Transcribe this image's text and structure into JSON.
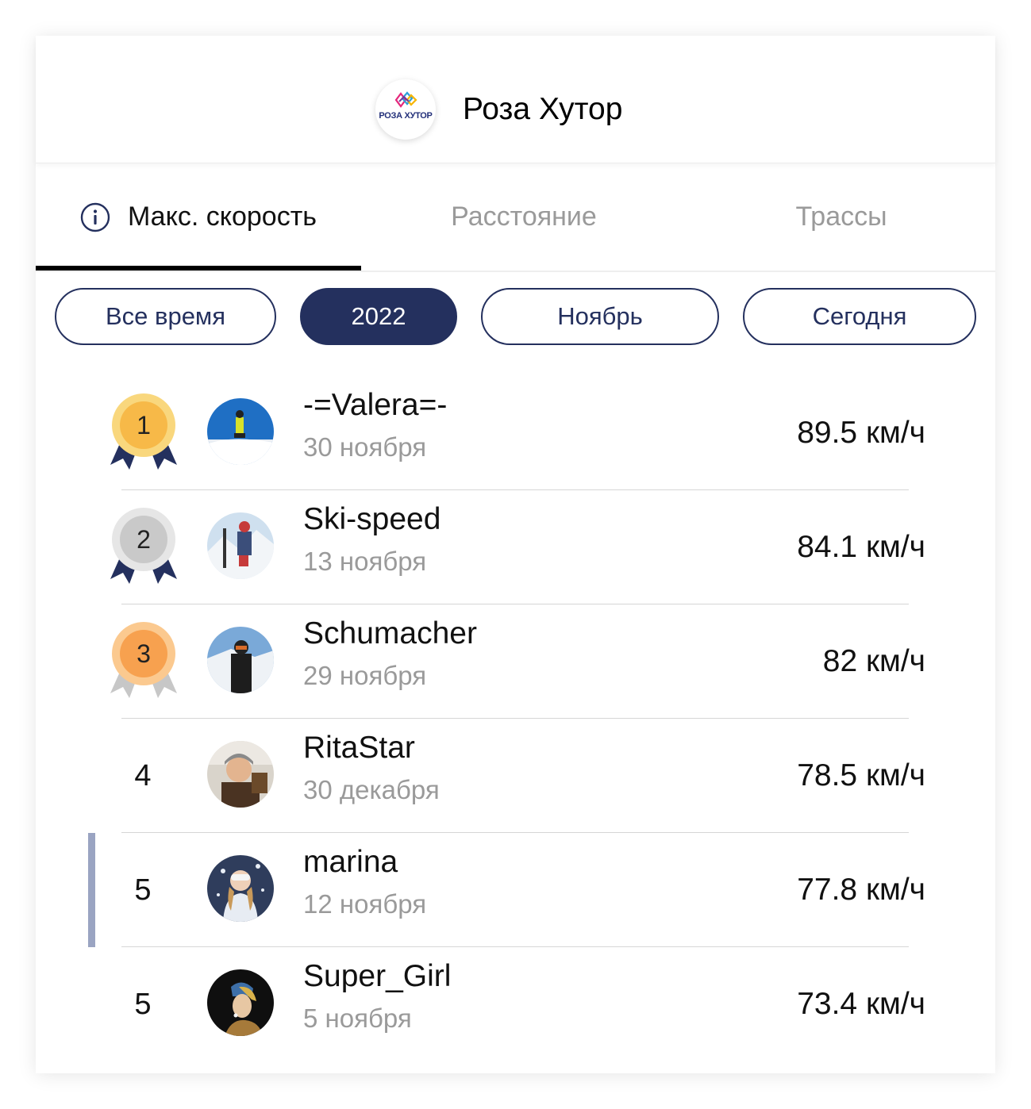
{
  "header": {
    "logo_text": "РОЗА ХУТОР",
    "title": "Роза Хутор"
  },
  "tabs": [
    {
      "label": "Макс. скорость",
      "active": true,
      "icon": "info-icon"
    },
    {
      "label": "Расстояние",
      "active": false
    },
    {
      "label": "Трассы",
      "active": false
    }
  ],
  "filters": [
    {
      "label": "Все время",
      "selected": false
    },
    {
      "label": "2022",
      "selected": true
    },
    {
      "label": "Ноябрь",
      "selected": false
    },
    {
      "label": "Сегодня",
      "selected": false
    }
  ],
  "leaderboard": [
    {
      "rank": "1",
      "medal": "gold",
      "name": "-=Valera=-",
      "date": "30 ноября",
      "speed": "89.5 км/ч"
    },
    {
      "rank": "2",
      "medal": "silver",
      "name": "Ski-speed",
      "date": "13 ноября",
      "speed": "84.1 км/ч"
    },
    {
      "rank": "3",
      "medal": "bronze",
      "name": "Schumacher",
      "date": "29 ноября",
      "speed": "82 км/ч"
    },
    {
      "rank": "4",
      "medal": "",
      "name": "RitaStar",
      "date": "30 декабря",
      "speed": "78.5 км/ч"
    },
    {
      "rank": "5",
      "medal": "",
      "name": "marina",
      "date": "12 ноября",
      "speed": "77.8 км/ч",
      "current_user": true
    },
    {
      "rank": "5",
      "medal": "",
      "name": "Super_Girl",
      "date": "5 ноября",
      "speed": "73.4 км/ч"
    }
  ],
  "colors": {
    "accent": "#24305e",
    "gold": "#f7bf4f",
    "silver": "#cfcfcf",
    "bronze": "#f7a14f",
    "ribbon": "#24305e",
    "current_marker": "#9aa4c2"
  }
}
